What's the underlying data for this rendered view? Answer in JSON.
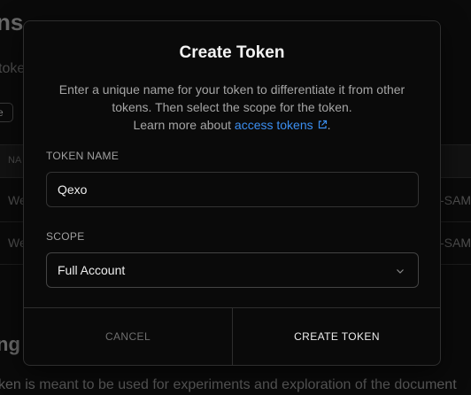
{
  "background": {
    "title_fragment": "ns",
    "subtitle_fragment": "toke",
    "button_fragment": "e",
    "table_header_fragment": "NA",
    "rows": [
      {
        "left": "We",
        "right": "-SAM"
      },
      {
        "left": "We",
        "right": "-SAM"
      }
    ],
    "section_heading_fragment": "ng",
    "paragraph_fragment": "ken is meant to be used for experiments and exploration of the document"
  },
  "modal": {
    "title": "Create Token",
    "description_line1": "Enter a unique name for your token to differentiate it from other",
    "description_line2": "tokens. Then select the scope for the token.",
    "description_line3_prefix": "Learn more about",
    "description_link": "access tokens",
    "description_line3_suffix": ".",
    "token_name_label": "TOKEN NAME",
    "token_name_value": "Qexo",
    "scope_label": "SCOPE",
    "scope_value": "Full Account",
    "cancel_label": "CANCEL",
    "create_label": "CREATE TOKEN"
  },
  "colors": {
    "link": "#3b8ef0",
    "background": "#0a0a0a",
    "border": "#2e2e2e"
  },
  "icons": {
    "external_link": "external-link-icon",
    "chevron": "chevron-down-icon"
  }
}
